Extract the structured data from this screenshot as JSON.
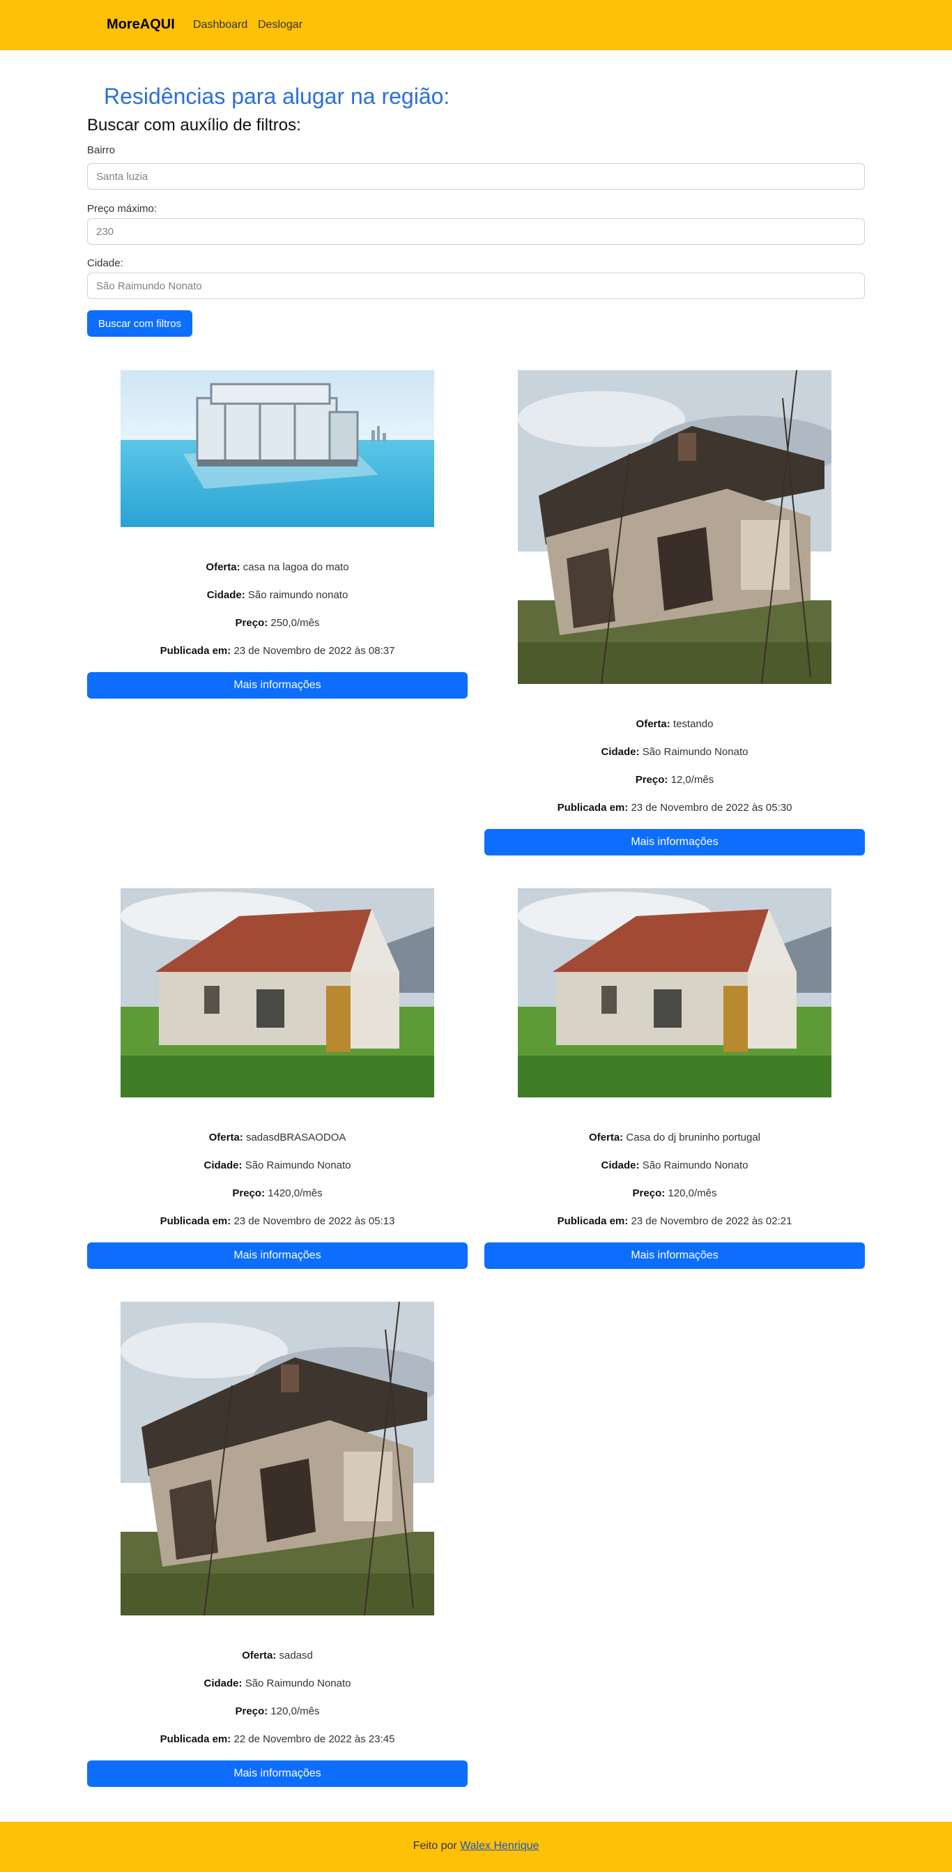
{
  "navbar": {
    "brand": "MoreAQUI",
    "links": [
      "Dashboard",
      "Deslogar"
    ]
  },
  "page_title": "Residências para alugar na região:",
  "subtitle": "Buscar com auxílio de filtros:",
  "filters": {
    "bairro_label": "Bairro",
    "bairro_placeholder": "Santa luzia",
    "preco_label": "Preço máximo:",
    "preco_placeholder": "230",
    "cidade_label": "Cidade:",
    "cidade_placeholder": "São Raimundo Nonato",
    "button_label": "Buscar com filtros"
  },
  "field_labels": {
    "oferta": "Oferta:",
    "cidade": "Cidade:",
    "preco": "Preço:",
    "publicada": "Publicada em:"
  },
  "listings": [
    {
      "oferta": "casa na lagoa do mato",
      "cidade": "São raimundo nonato",
      "preco": "250,0/mês",
      "publicada": "23 de Novembro de 2022 às 08:37",
      "button": "Mais informações",
      "image": "floating-glass-house-photo"
    },
    {
      "oferta": "testando",
      "cidade": "São Raimundo Nonato",
      "preco": "12,0/mês",
      "publicada": "23 de Novembro de 2022 às 05:30",
      "button": "Mais informações",
      "image": "collapsed-wooden-house-photo"
    },
    {
      "oferta": "sadasdBRASAODOA",
      "cidade": "São Raimundo Nonato",
      "preco": "1420,0/mês",
      "publicada": "23 de Novembro de 2022 às 05:13",
      "button": "Mais informações",
      "image": "abandoned-cottage-rusty-roof-photo"
    },
    {
      "oferta": "Casa do dj bruninho portugal",
      "cidade": "São Raimundo Nonato",
      "preco": "120,0/mês",
      "publicada": "23 de Novembro de 2022 às 02:21",
      "button": "Mais informações",
      "image": "abandoned-cottage-rusty-roof-photo"
    },
    {
      "oferta": "sadasd",
      "cidade": "São Raimundo Nonato",
      "preco": "120,0/mês",
      "publicada": "22 de Novembro de 2022 às 23:45",
      "button": "Mais informações",
      "image": "collapsed-wooden-house-photo"
    }
  ],
  "footer": {
    "text": "Feito por",
    "link": "Walex Henrique"
  },
  "colors": {
    "navbar": "#ffc107",
    "title": "#2a6fdb",
    "primary_button": "#0d6efd"
  }
}
